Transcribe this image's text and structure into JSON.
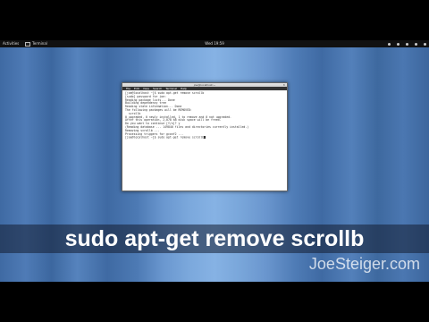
{
  "topbar": {
    "activities": "Activities",
    "app_name": "Terminal",
    "clock": "Wed 19:59"
  },
  "terminal": {
    "title": "joe@localhost:~",
    "menu": [
      "File",
      "Edit",
      "View",
      "Search",
      "Terminal",
      "Help"
    ],
    "lines": [
      "[joe@localhost ~]$ sudo apt-get remove scrollb",
      "[sudo] password for joe:",
      "Reading package lists... Done",
      "Building dependency tree",
      "Reading state information... Done",
      "The following packages will be REMOVED:",
      "  scrollb",
      "0 upgraded, 0 newly installed, 1 to remove and 0 not upgraded.",
      "After this operation, 2,078 kB disk space will be freed.",
      "Do you want to continue [Y/n]? y",
      "(Reading database ... 149840 files and directories currently installed.)",
      "Removing scrollb ...",
      "Processing triggers for gconf2 ...",
      "[joe@localhost ~]$ sudo apt-get remove scrollb"
    ]
  },
  "caption": "sudo apt-get remove scrollb",
  "watermark": "JoeSteiger.com"
}
